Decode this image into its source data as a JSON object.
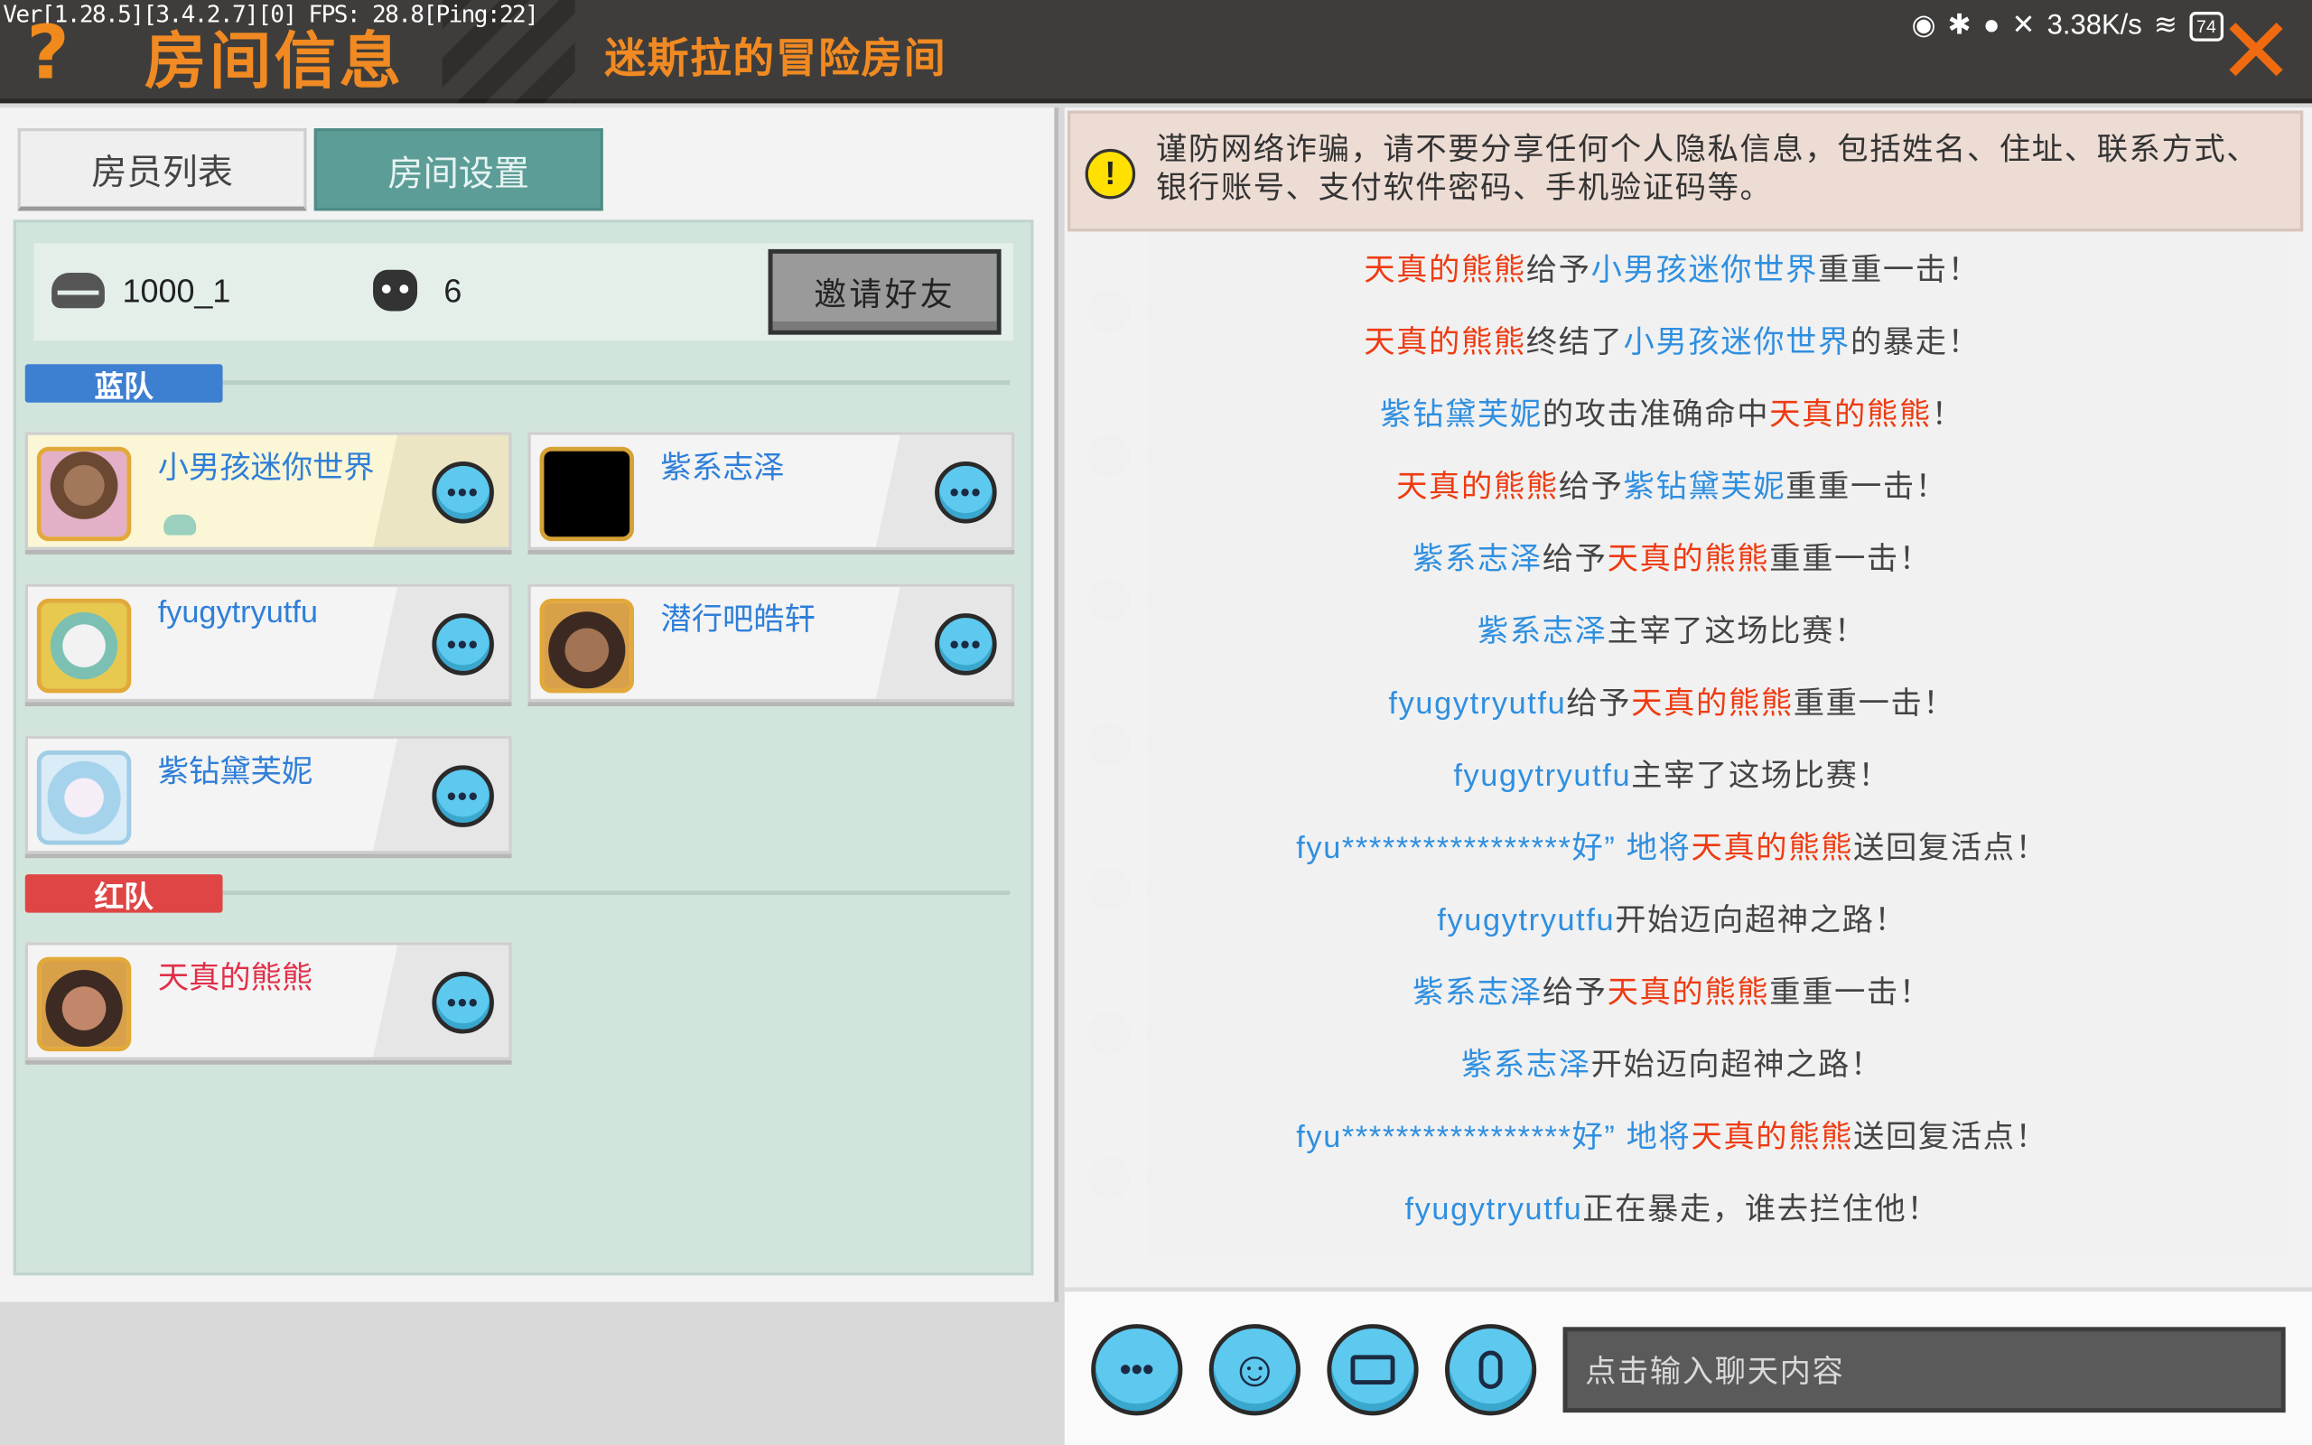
{
  "status_bar": {
    "debug": "Ver[1.28.5][3.4.2.7][0] FPS: 28.8[Ping:22]",
    "net_speed": "3.38K/s",
    "battery": "74"
  },
  "header": {
    "title": "房间信息",
    "room_name": "迷斯拉的冒险房间",
    "help_glyph": "?",
    "close_glyph": "✕"
  },
  "tabs": [
    {
      "label": "房员列表",
      "active": false
    },
    {
      "label": "房间设置",
      "active": true
    }
  ],
  "room_info": {
    "room_id": "1000_1",
    "player_count": "6",
    "invite_label": "邀请好友"
  },
  "teams": {
    "blue": {
      "label": "蓝队",
      "members": [
        {
          "name": "小男孩迷你世界",
          "avatar": "avatar-character"
        },
        {
          "name": "紫系志泽",
          "avatar": "avatar-black"
        },
        {
          "name": "fyugytryutfu",
          "avatar": "avatar-robot"
        },
        {
          "name": "潜行吧皓轩",
          "avatar": "avatar-character"
        },
        {
          "name": "紫钻黛芙妮",
          "avatar": "avatar-anime"
        }
      ]
    },
    "red": {
      "label": "红队",
      "members": [
        {
          "name": "天真的熊熊",
          "avatar": "avatar-character"
        }
      ]
    }
  },
  "more_glyph": "•••",
  "warning": {
    "icon": "!",
    "text": "谨防网络诈骗，请不要分享任何个人隐私信息，包括姓名、住址、联系方式、银行账号、支付软件密码、手机验证码等。"
  },
  "messages": [
    [
      {
        "t": "天真的熊熊",
        "c": "r"
      },
      {
        "t": "给予",
        "c": ""
      },
      {
        "t": "小男孩迷你世界",
        "c": "b"
      },
      {
        "t": "重重一击！",
        "c": ""
      }
    ],
    [
      {
        "t": "天真的熊熊",
        "c": "r"
      },
      {
        "t": "终结了",
        "c": ""
      },
      {
        "t": "小男孩迷你世界",
        "c": "b"
      },
      {
        "t": "的暴走！",
        "c": ""
      }
    ],
    [
      {
        "t": "紫钻黛芙妮",
        "c": "b"
      },
      {
        "t": "的攻击准确命中",
        "c": ""
      },
      {
        "t": "天真的熊熊",
        "c": "r"
      },
      {
        "t": "！",
        "c": ""
      }
    ],
    [
      {
        "t": "天真的熊熊",
        "c": "r"
      },
      {
        "t": "给予",
        "c": ""
      },
      {
        "t": "紫钻黛芙妮",
        "c": "b"
      },
      {
        "t": "重重一击！",
        "c": ""
      }
    ],
    [
      {
        "t": "紫系志泽",
        "c": "b"
      },
      {
        "t": "给予",
        "c": ""
      },
      {
        "t": "天真的熊熊",
        "c": "r"
      },
      {
        "t": "重重一击！",
        "c": ""
      }
    ],
    [
      {
        "t": "紫系志泽",
        "c": "b"
      },
      {
        "t": "主宰了这场比赛！",
        "c": ""
      }
    ],
    [
      {
        "t": "fyugytryutfu",
        "c": "b"
      },
      {
        "t": "给予",
        "c": ""
      },
      {
        "t": "天真的熊熊",
        "c": "r"
      },
      {
        "t": "重重一击！",
        "c": ""
      }
    ],
    [
      {
        "t": "fyugytryutfu",
        "c": "b"
      },
      {
        "t": "主宰了这场比赛！",
        "c": ""
      }
    ],
    [
      {
        "t": "fyu*****************好” 地将",
        "c": "b"
      },
      {
        "t": "天真的熊熊",
        "c": "r"
      },
      {
        "t": "送回复活点！",
        "c": ""
      }
    ],
    [
      {
        "t": "fyugytryutfu",
        "c": "b"
      },
      {
        "t": "开始迈向超神之路！",
        "c": ""
      }
    ],
    [
      {
        "t": "紫系志泽",
        "c": "b"
      },
      {
        "t": "给予",
        "c": ""
      },
      {
        "t": "天真的熊熊",
        "c": "r"
      },
      {
        "t": "重重一击！",
        "c": ""
      }
    ],
    [
      {
        "t": "紫系志泽",
        "c": "b"
      },
      {
        "t": "开始迈向超神之路！",
        "c": ""
      }
    ],
    [
      {
        "t": "fyu*****************好” 地将",
        "c": "b"
      },
      {
        "t": "天真的熊熊",
        "c": "r"
      },
      {
        "t": "送回复活点！",
        "c": ""
      }
    ],
    [
      {
        "t": "fyugytryutfu",
        "c": "b"
      },
      {
        "t": "正在暴走，谁去拦住他！",
        "c": ""
      }
    ]
  ],
  "chat_bar": {
    "more_glyph": "•••",
    "emoji_glyph": "☺",
    "input_placeholder": "点击输入聊天内容"
  },
  "colors": {
    "accent_orange": "#f18a22",
    "team_blue": "#3d7fd1",
    "team_red": "#e04545",
    "name_blue": "#2f8fe0",
    "name_red": "#ee3b12"
  }
}
